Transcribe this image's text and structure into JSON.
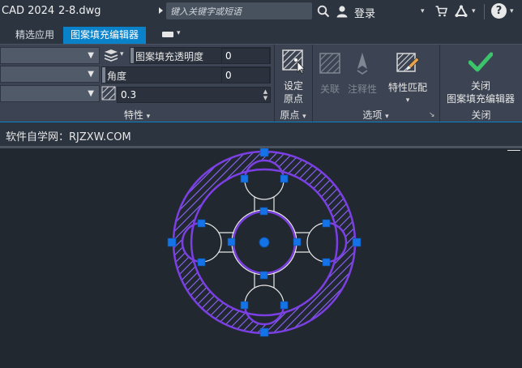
{
  "titlebar": {
    "app_name": "CAD 2024",
    "file_name": "2-8.dwg",
    "search_placeholder": "键入关键字或短语",
    "login_label": "登录"
  },
  "tabs": [
    {
      "label": "精选应用",
      "active": false
    },
    {
      "label": "图案填充编辑器",
      "active": true
    }
  ],
  "ribbon": {
    "properties": {
      "transparency_label": "图案填充透明度",
      "transparency_value": "0",
      "angle_label": "角度",
      "angle_value": "0",
      "scale_value": "0.3",
      "panel_title": "特性"
    },
    "origin": {
      "button_label_line1": "设定",
      "button_label_line2": "原点",
      "panel_title": "原点"
    },
    "options": {
      "associative_label": "关联",
      "annotative_label": "注释性",
      "match_label": "特性匹配",
      "panel_title": "选项"
    },
    "close": {
      "button_label_line1": "关闭",
      "button_label_line2": "图案填充编辑器",
      "panel_title": "关闭"
    }
  },
  "infobar": {
    "text": "软件自学网：RJZXW.COM"
  },
  "colors": {
    "accent": "#0a82c9",
    "outline": "#7b3fe4",
    "grip": "#1473e6",
    "hatch": "#8f66ff",
    "check": "#3cc46b"
  }
}
